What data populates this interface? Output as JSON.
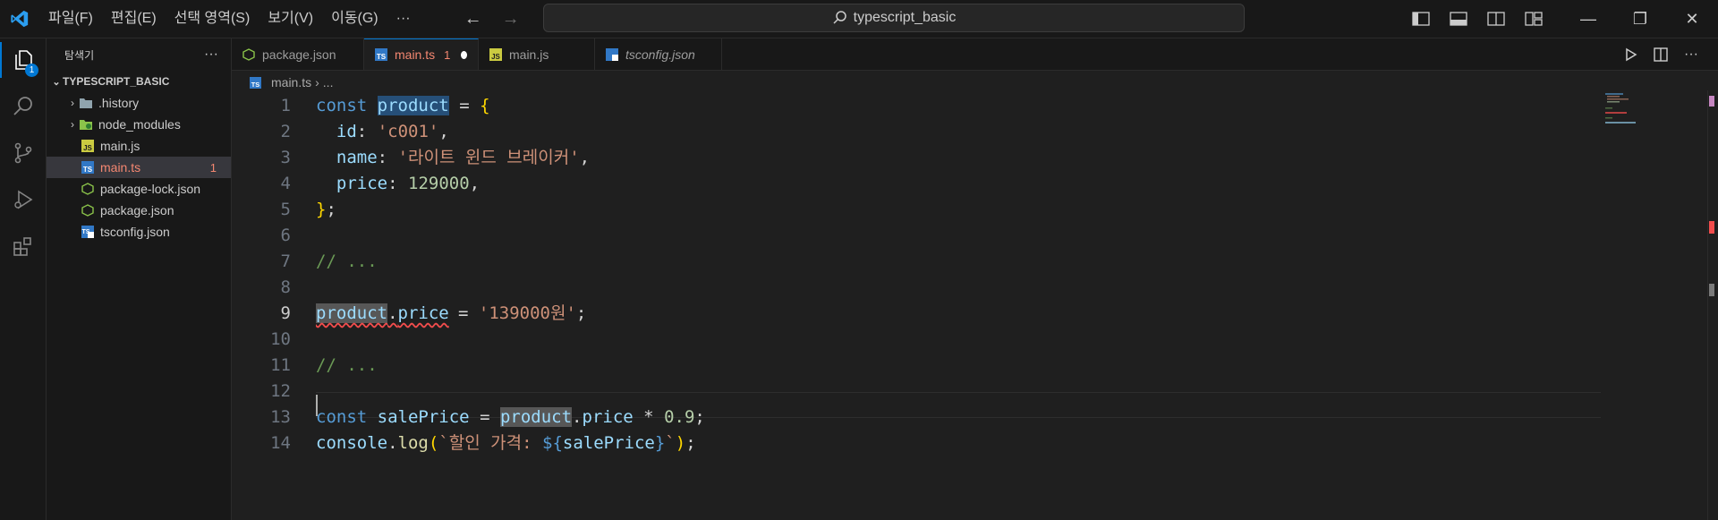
{
  "menu": [
    "파일(F)",
    "편집(E)",
    "선택 영역(S)",
    "보기(V)",
    "이동(G)",
    "···"
  ],
  "search": {
    "text": "typescript_basic"
  },
  "explorer": {
    "title": "탐색기",
    "badge": "1",
    "folder": "TYPESCRIPT_BASIC",
    "items": [
      {
        "label": ".history",
        "icon": "folder-icon",
        "expandable": true
      },
      {
        "label": "node_modules",
        "icon": "node-folder-icon",
        "expandable": true
      },
      {
        "label": "main.js",
        "icon": "js-file-icon"
      },
      {
        "label": "main.ts",
        "icon": "ts-file-icon",
        "errors": "1",
        "selected": true
      },
      {
        "label": "package-lock.json",
        "icon": "node-file-icon"
      },
      {
        "label": "package.json",
        "icon": "node-file-icon"
      },
      {
        "label": "tsconfig.json",
        "icon": "ts-config-icon"
      }
    ]
  },
  "tabs": [
    {
      "label": "package.json",
      "icon": "node-file-icon"
    },
    {
      "label": "main.ts",
      "icon": "ts-file-icon",
      "active": true,
      "problems": "1",
      "modified": true
    },
    {
      "label": "main.js",
      "icon": "js-file-icon"
    },
    {
      "label": "tsconfig.json",
      "icon": "ts-config-icon",
      "italic": true
    }
  ],
  "breadcrumb": {
    "file": "main.ts",
    "rest": "..."
  },
  "editor": {
    "line_numbers": [
      "1",
      "2",
      "3",
      "4",
      "5",
      "6",
      "7",
      "8",
      "9",
      "10",
      "11",
      "12",
      "13",
      "14"
    ],
    "current_line": "9",
    "code": {
      "l1": [
        "const",
        "product",
        "=",
        "{"
      ],
      "l2": [
        "id",
        ":",
        "'c001'",
        ","
      ],
      "l3": [
        "name",
        ":",
        "'라이트 윈드 브레이커'",
        ","
      ],
      "l4": [
        "price",
        ":",
        "129000",
        ","
      ],
      "l5": [
        "}",
        ";"
      ],
      "l7": "// ...",
      "l9": [
        "product",
        ".",
        "price",
        "=",
        "'139000원'",
        ";"
      ],
      "l11": "// ...",
      "l13": [
        "const",
        "salePrice",
        "=",
        "product",
        ".",
        "price",
        "*",
        "0.9",
        ";"
      ],
      "l14": [
        "console",
        ".",
        "log",
        "(",
        "`할인 가격: ",
        "${",
        "salePrice",
        "}",
        "`",
        ")",
        ";"
      ]
    }
  },
  "colors": {
    "accent": "#0078d4",
    "error": "#f48771",
    "background": "#1f1f1f"
  }
}
